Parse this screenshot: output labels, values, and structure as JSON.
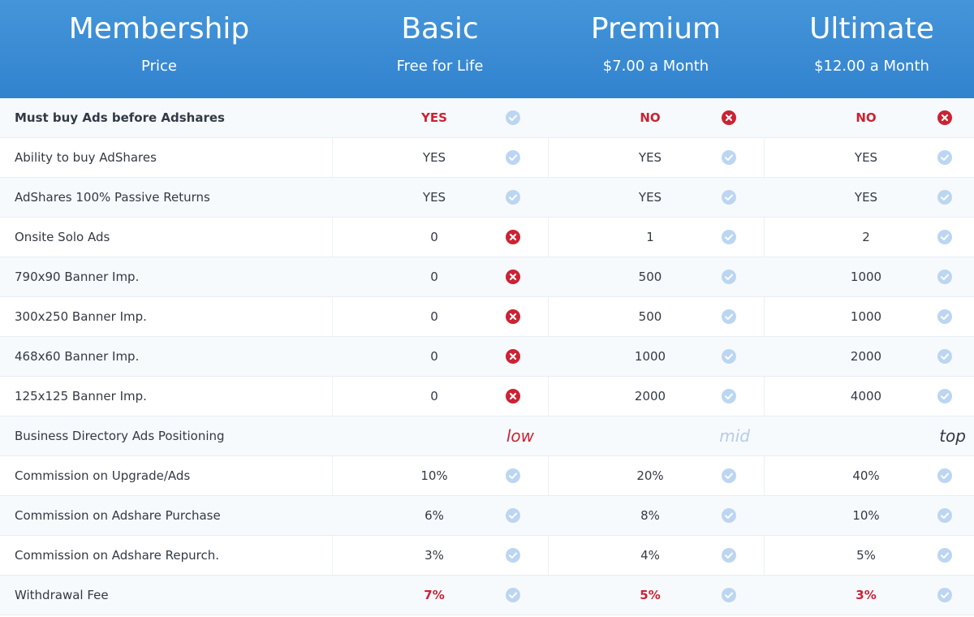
{
  "header": {
    "title": "Membership",
    "subtitle": "Price",
    "plans": [
      {
        "name": "Basic",
        "price": "Free for Life"
      },
      {
        "name": "Premium",
        "price": "$7.00 a Month"
      },
      {
        "name": "Ultimate",
        "price": "$12.00 a Month"
      }
    ]
  },
  "colors": {
    "header_blue": "#3a8ad4",
    "check_blue": "#bcd6f2",
    "cross_red": "#cc2233",
    "tier_low": "#cc2233",
    "tier_mid": "#b5cce6",
    "tier_top": "#333a45"
  },
  "rows": [
    {
      "label": "Must buy Ads before Adshares",
      "bold": true,
      "cells": [
        {
          "value": "YES",
          "style": "red",
          "icon": "check-icon"
        },
        {
          "value": "NO",
          "style": "red",
          "icon": "cross-icon"
        },
        {
          "value": "NO",
          "style": "red",
          "icon": "cross-icon"
        }
      ]
    },
    {
      "label": "Ability to buy AdShares",
      "cells": [
        {
          "value": "YES",
          "icon": "check-icon"
        },
        {
          "value": "YES",
          "icon": "check-icon"
        },
        {
          "value": "YES",
          "icon": "check-icon"
        }
      ]
    },
    {
      "label": "AdShares 100% Passive Returns",
      "cells": [
        {
          "value": "YES",
          "icon": "check-icon"
        },
        {
          "value": "YES",
          "icon": "check-icon"
        },
        {
          "value": "YES",
          "icon": "check-icon"
        }
      ]
    },
    {
      "label": "Onsite Solo Ads",
      "cells": [
        {
          "value": "0",
          "icon": "cross-icon"
        },
        {
          "value": "1",
          "icon": "check-icon"
        },
        {
          "value": "2",
          "icon": "check-icon"
        }
      ]
    },
    {
      "label": "790x90 Banner Imp.",
      "cells": [
        {
          "value": "0",
          "icon": "cross-icon"
        },
        {
          "value": "500",
          "icon": "check-icon"
        },
        {
          "value": "1000",
          "icon": "check-icon"
        }
      ]
    },
    {
      "label": "300x250 Banner Imp.",
      "cells": [
        {
          "value": "0",
          "icon": "cross-icon"
        },
        {
          "value": "500",
          "icon": "check-icon"
        },
        {
          "value": "1000",
          "icon": "check-icon"
        }
      ]
    },
    {
      "label": "468x60 Banner Imp.",
      "cells": [
        {
          "value": "0",
          "icon": "cross-icon"
        },
        {
          "value": "1000",
          "icon": "check-icon"
        },
        {
          "value": "2000",
          "icon": "check-icon"
        }
      ]
    },
    {
      "label": "125x125 Banner Imp.",
      "cells": [
        {
          "value": "0",
          "icon": "cross-icon"
        },
        {
          "value": "2000",
          "icon": "check-icon"
        },
        {
          "value": "4000",
          "icon": "check-icon"
        }
      ]
    },
    {
      "label": "Business Directory Ads Positioning",
      "cells": [
        {
          "value": "low",
          "style": "tier-low"
        },
        {
          "value": "mid",
          "style": "tier-mid"
        },
        {
          "value": "top",
          "style": "tier-top"
        }
      ]
    },
    {
      "label": "Commission on Upgrade/Ads",
      "cells": [
        {
          "value": "10%",
          "icon": "check-icon"
        },
        {
          "value": "20%",
          "icon": "check-icon"
        },
        {
          "value": "40%",
          "icon": "check-icon"
        }
      ]
    },
    {
      "label": "Commission on Adshare Purchase",
      "cells": [
        {
          "value": "6%",
          "icon": "check-icon"
        },
        {
          "value": "8%",
          "icon": "check-icon"
        },
        {
          "value": "10%",
          "icon": "check-icon"
        }
      ]
    },
    {
      "label": "Commission on Adshare Repurch.",
      "cells": [
        {
          "value": "3%",
          "icon": "check-icon"
        },
        {
          "value": "4%",
          "icon": "check-icon"
        },
        {
          "value": "5%",
          "icon": "check-icon"
        }
      ]
    },
    {
      "label": "Withdrawal Fee",
      "cells": [
        {
          "value": "7%",
          "style": "red",
          "icon": "check-icon"
        },
        {
          "value": "5%",
          "style": "red",
          "icon": "check-icon"
        },
        {
          "value": "3%",
          "style": "red",
          "icon": "check-icon"
        }
      ]
    }
  ]
}
